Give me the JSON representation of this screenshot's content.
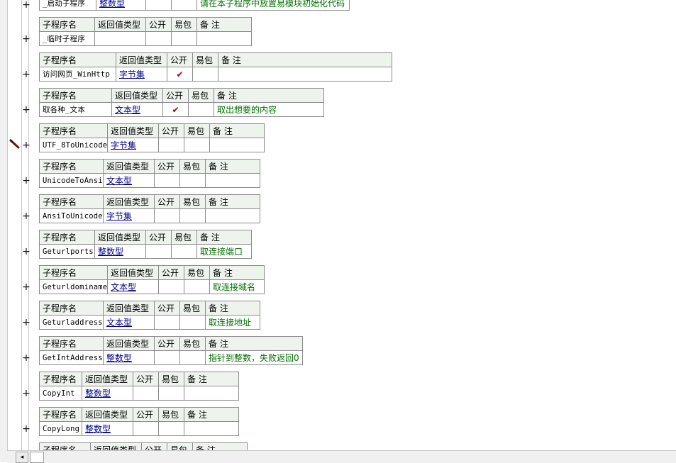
{
  "headers": {
    "name": "子程序名",
    "return_type": "返回值类型",
    "public": "公开",
    "easy_pack": "易包",
    "note": "备 注"
  },
  "expand_symbol": "+",
  "check_symbol": "✔",
  "scroll_left_symbol": "◂",
  "subs": [
    {
      "name": "_启动子程序",
      "type": "整数型",
      "public": "",
      "easy": "",
      "note": "请在本子程序中放置易模块初始化代码"
    },
    {
      "name": "_临时子程序",
      "type": "",
      "public": "",
      "easy": "",
      "note": ""
    },
    {
      "name": "访问网页_WinHttp",
      "type": "字节集",
      "public": "✔",
      "easy": "",
      "note": ""
    },
    {
      "name": "取各种_文本",
      "type": "文本型",
      "public": "✔",
      "easy": "",
      "note": "取出想要的内容"
    },
    {
      "name": "UTF_8ToUnicode",
      "type": "字节集",
      "public": "",
      "easy": "",
      "note": ""
    },
    {
      "name": "UnicodeToAnsi",
      "type": "文本型",
      "public": "",
      "easy": "",
      "note": ""
    },
    {
      "name": "AnsiToUnicode",
      "type": "字节集",
      "public": "",
      "easy": "",
      "note": ""
    },
    {
      "name": "Geturlports",
      "type": "整数型",
      "public": "",
      "easy": "",
      "note": "取连接端口"
    },
    {
      "name": "Geturldominame",
      "type": "文本型",
      "public": "",
      "easy": "",
      "note": "取连接域名"
    },
    {
      "name": "Geturladdress",
      "type": "文本型",
      "public": "",
      "easy": "",
      "note": "取连接地址"
    },
    {
      "name": "GetIntAddress",
      "type": "整数型",
      "public": "",
      "easy": "",
      "note": "指针到整数，失败返回0"
    },
    {
      "name": "CopyInt",
      "type": "整数型",
      "public": "",
      "easy": "",
      "note": ""
    },
    {
      "name": "CopyLong",
      "type": "整数型",
      "public": "",
      "easy": "",
      "note": ""
    }
  ]
}
